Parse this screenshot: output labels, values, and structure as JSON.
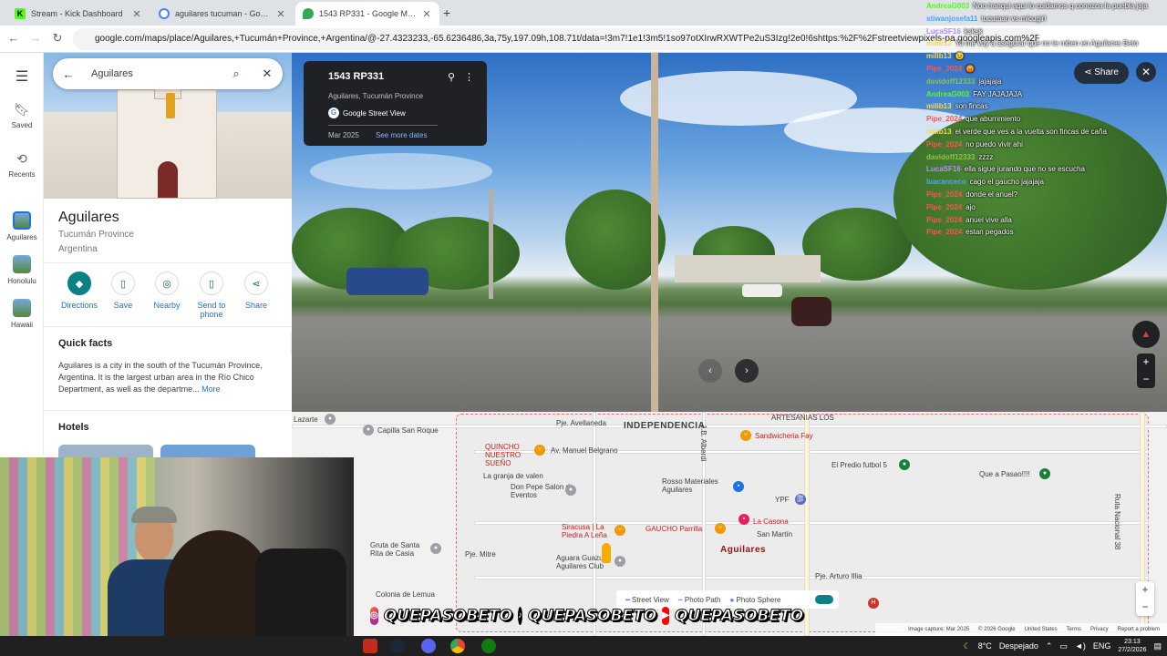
{
  "browser": {
    "tabs": [
      {
        "title": "Stream - Kick Dashboard",
        "color": "#53fc18"
      },
      {
        "title": "aguilares tucuman - Google Search",
        "color": "#4285f4"
      },
      {
        "title": "1543 RP331 - Google Maps",
        "color": "#34a853"
      }
    ],
    "new_tab": "+",
    "url": "google.com/maps/place/Aguilares,+Tucumán+Province,+Argentina/@-27.4323233,-65.6236486,3a,75y,197.09h,108.71t/data=!3m7!1e1!3m5!1so97otXIrwRXWTPe2uS3Izg!2e0!6shttps:%2F%2Fstreetviewpixels-pa.googleapis.com%2F"
  },
  "rail": {
    "items": [
      {
        "label": "Saved"
      },
      {
        "label": "Recents"
      },
      {
        "label": "Aguilares"
      },
      {
        "label": "Honolulu"
      },
      {
        "label": "Hawaii"
      }
    ]
  },
  "search": {
    "value": "Aguilares"
  },
  "place": {
    "title": "Aguilares",
    "province": "Tucumán Province",
    "country": "Argentina",
    "actions": [
      "Directions",
      "Save",
      "Nearby",
      "Send to phone",
      "Share"
    ],
    "quick_facts_title": "Quick facts",
    "quick_facts": "Aguilares is a city in the south of the Tucumán Province, Argentina. It is the largest urban area in the Río Chico Department, as well as the departme...",
    "more": "More",
    "hotels_title": "Hotels"
  },
  "streetview": {
    "title": "1543 RP331",
    "subtitle": "Aguilares, Tucumán Province",
    "source": "Google Street View",
    "date": "Mar 2025",
    "see_more": "See more dates",
    "share": "Share"
  },
  "chat": [
    {
      "user": "AndreaG003",
      "msg": "Noo tranqui aqui lo cuidamos q conozca la puebla jaja",
      "color": "#53fc18"
    },
    {
      "user": "stiwanjosefa11",
      "msg": "tucuman vs micugirl",
      "color": "#4aa3ff"
    },
    {
      "user": "LucaSF16",
      "msg": "ksksk",
      "color": "#b48cff"
    },
    {
      "user": "milib13",
      "msg": "Yo me voy a asegurar que no te roben en Aguilares Beto",
      "color": "#ffd54a"
    },
    {
      "user": "milib13",
      "msg": "😉",
      "color": "#ffd54a"
    },
    {
      "user": "Pipe_2024",
      "msg": "😡",
      "color": "#ff5252"
    },
    {
      "user": "davidoff12333",
      "msg": "jajajaja",
      "color": "#8bc34a"
    },
    {
      "user": "AndreaG003",
      "msg": "FAY JAJAJAJA",
      "color": "#53fc18"
    },
    {
      "user": "milib13",
      "msg": "son fincas",
      "color": "#ffd54a"
    },
    {
      "user": "Pipe_2024",
      "msg": "que aburrimiento",
      "color": "#ff5252"
    },
    {
      "user": "milib13",
      "msg": "el verde que ves a la vuelta son fincas de caña",
      "color": "#ffd54a"
    },
    {
      "user": "Pipe_2024",
      "msg": "no puedo vivir ahi",
      "color": "#ff5252"
    },
    {
      "user": "davidoff12333",
      "msg": "zzzz",
      "color": "#8bc34a"
    },
    {
      "user": "LucaSF16",
      "msg": "ella sigue jurando que no se escucha",
      "color": "#b48cff"
    },
    {
      "user": "luacanceco",
      "msg": "cago el gaucho jajajaja",
      "color": "#4aa3ff"
    },
    {
      "user": "Pipe_2024",
      "msg": "donde el anuel?",
      "color": "#ff5252"
    },
    {
      "user": "Pipe_2024",
      "msg": "ajo",
      "color": "#ff5252"
    },
    {
      "user": "Pipe_2024",
      "msg": "anuel vive alla",
      "color": "#ff5252"
    },
    {
      "user": "Pipe_2024",
      "msg": "estan pegados",
      "color": "#ff5252"
    }
  ],
  "map": {
    "labels": {
      "independencia": "INDEPENDENCIA",
      "capilla": "Capilla San Roque",
      "lazarte": "Lazarte",
      "avellaneda": "Pje. Avellaneda",
      "alberdi": "J.B. Alberdi",
      "artesanias": "ARTESANIAS LOS",
      "sandwicheria": "Sandwicheria Fay",
      "quincho": "QUINCHO NUESTRO SUEÑO",
      "manuel_belgrano": "Av. Manuel Belgrano",
      "granja": "La granja de valen",
      "don_pepe": "Don Pepe Salon de Eventos",
      "rosso": "Rosso Materiales Aguilares",
      "ypf": "YPF",
      "predio": "El Predio futbol 5",
      "que_a_pasao": "Que a Pasao!!!!",
      "sanmartin": "San Martín",
      "la_casona": "La Casona",
      "siracusa": "Siracusa | La Piedra A Leña",
      "gaucho": "GAUCHO Parrilla",
      "aguara": "Aguara Guazu Aguilares Club",
      "aguilares": "Aguilares",
      "gruta": "Gruta de Santa Rita de Casia",
      "colonia": "Colonia de Lemua",
      "mitre": "Pje. Mitre",
      "artes": "Pje. Arturo Illia",
      "ruta": "Ruta Nacional 38"
    },
    "legend": {
      "street_view": "Street View",
      "photo_path": "Photo Path",
      "photo_sphere": "Photo Sphere"
    },
    "footer": [
      "Image capture: Mar 2025",
      "© 2026 Google",
      "United States",
      "Terms",
      "Privacy",
      "Report a problem"
    ]
  },
  "overlay": {
    "socials": [
      "QUEPASOBETO",
      "QUEPASOBETO",
      "QUEPASOBETO"
    ]
  },
  "taskbar": {
    "weather": "8°C",
    "weather_desc": "Despejado",
    "lang": "ENG",
    "time": "23:13",
    "date": "27/2/2026"
  }
}
